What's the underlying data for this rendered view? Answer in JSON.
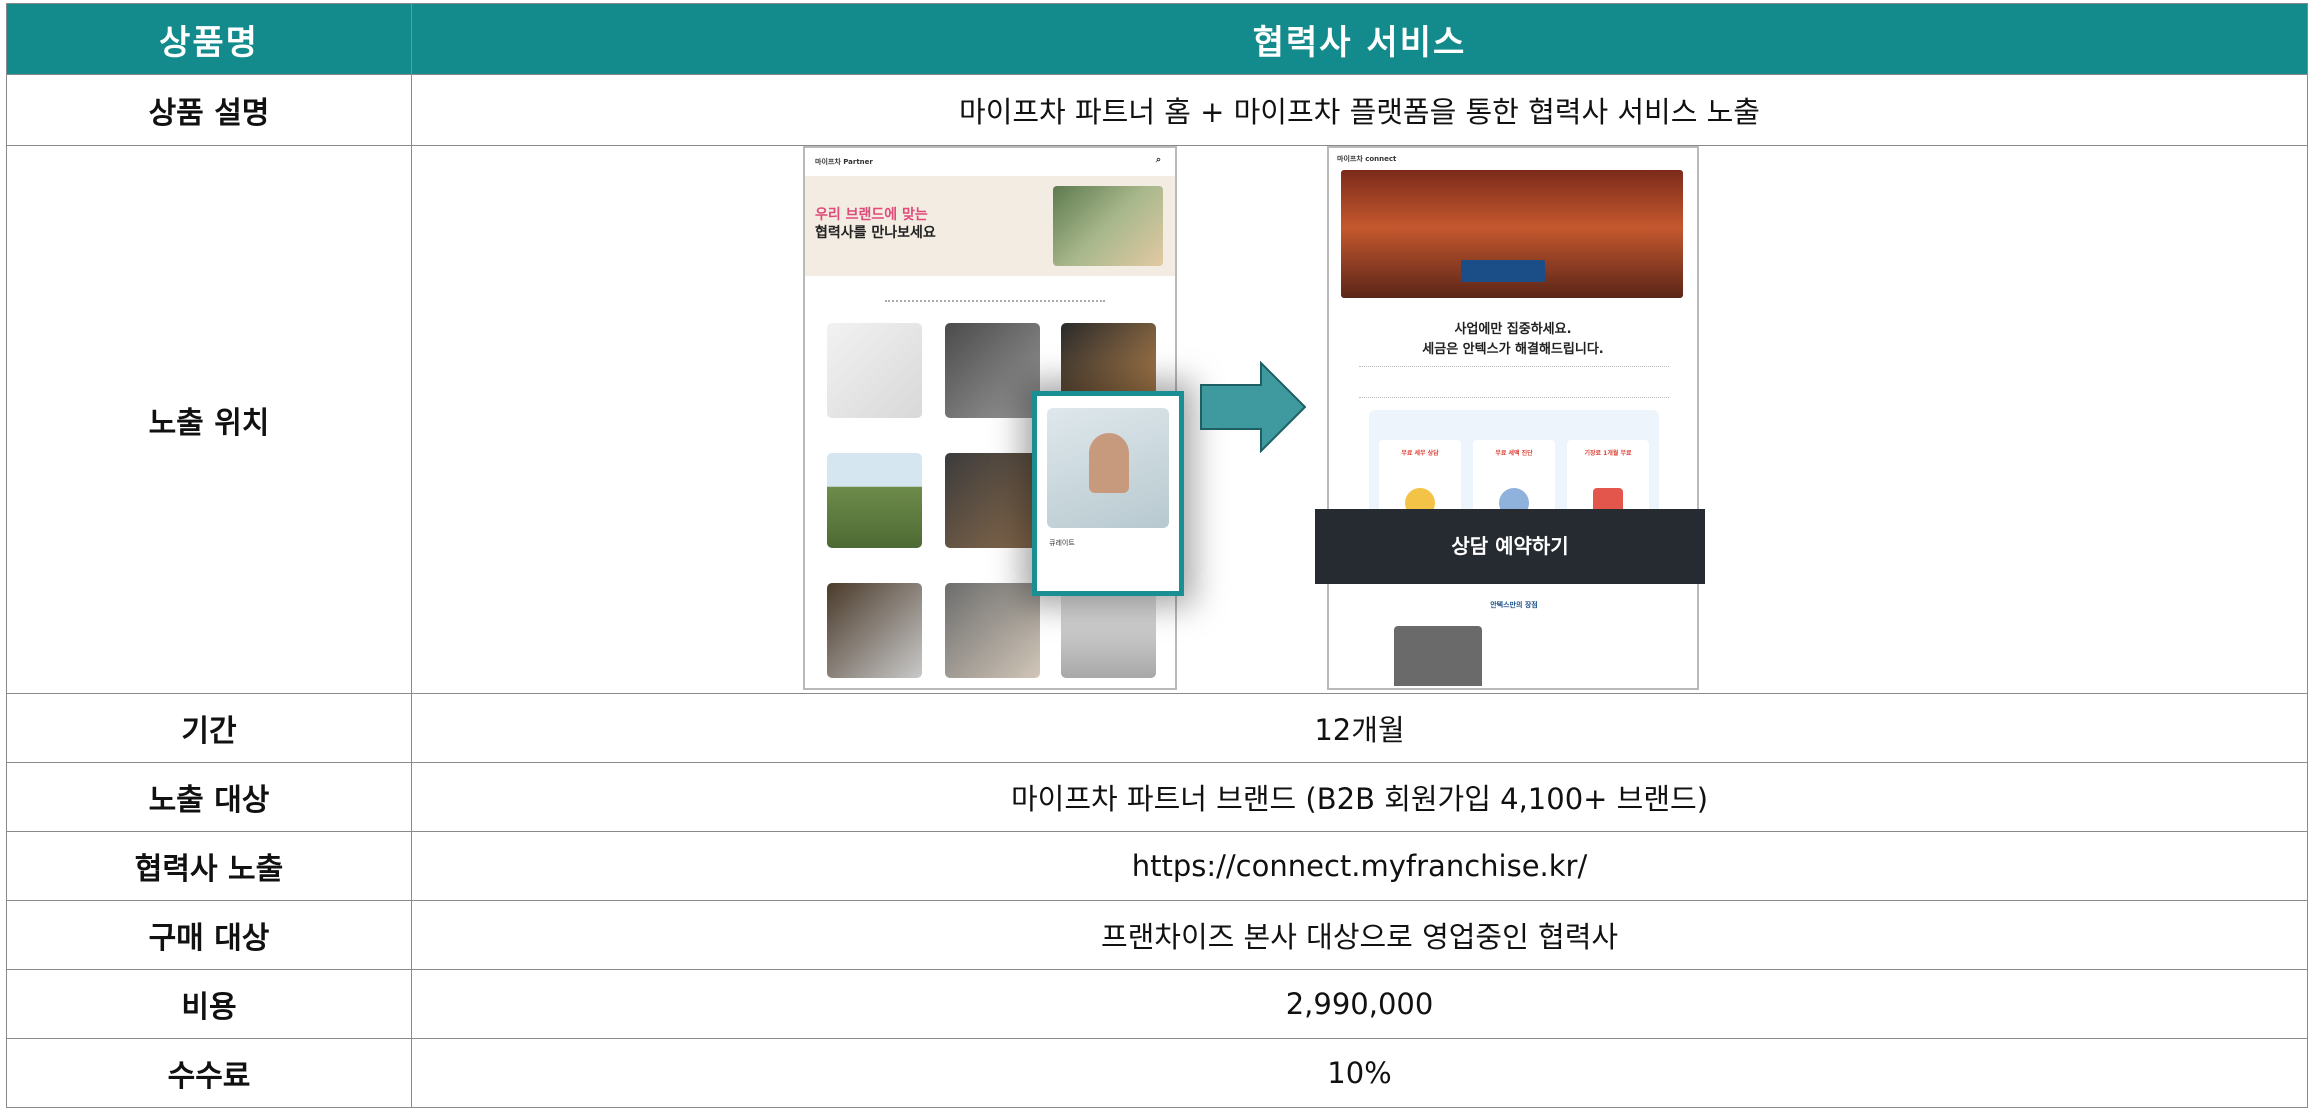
{
  "header": {
    "col1": "상품명",
    "col2": "협력사 서비스"
  },
  "rows": {
    "description": {
      "label": "상품 설명",
      "value": "마이프차 파트너 홈 + 마이프차 플랫폼을 통한 협력사 서비스 노출"
    },
    "placement": {
      "label": "노출 위치"
    },
    "period": {
      "label": "기간",
      "value": "12개월"
    },
    "audience": {
      "label": "노출 대상",
      "value": "마이프차 파트너 브랜드 (B2B 회원가입 4,100+ 브랜드)"
    },
    "partner_exposure": {
      "label": "협력사 노출",
      "value": "https://connect.myfranchise.kr/"
    },
    "buyer": {
      "label": "구매 대상",
      "value": "프랜차이즈 본사 대상으로 영업중인 협력사"
    },
    "cost": {
      "label": "비용",
      "value": "2,990,000"
    },
    "fee": {
      "label": "수수료",
      "value": "10%"
    }
  },
  "mockups": {
    "left": {
      "logo": "마이프차 Partner",
      "hero_line1": "우리 브랜드에 맞는",
      "hero_line2": "협력사를 만나보세요",
      "overlay_caption": "큐레이트"
    },
    "right": {
      "logo": "마이프차 connect",
      "headline1": "사업에만 집중하세요.",
      "headline2": "세금은 안텍스가 해결해드립니다.",
      "card_labels": [
        "무료 세무 상담",
        "무료 세액 진단",
        "기장료 1개월 무료"
      ],
      "cta": "상담 예약하기",
      "bottom_title": "안텍스만의 장점"
    }
  },
  "colors": {
    "header_bg": "#138a8c",
    "arrow": "#3f9aa0",
    "cta_bg": "#262b31"
  }
}
